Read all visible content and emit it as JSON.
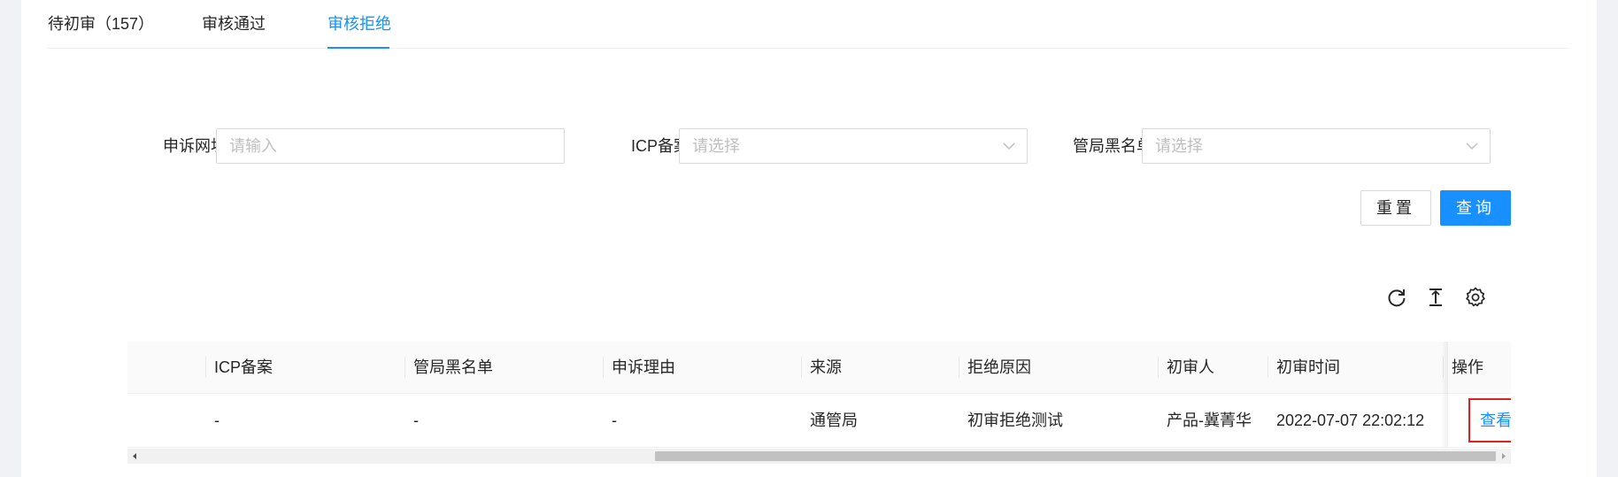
{
  "tabs": [
    {
      "label": "待初审（157）",
      "active": false
    },
    {
      "label": "审核通过",
      "active": false
    },
    {
      "label": "审核拒绝",
      "active": true
    }
  ],
  "filters": {
    "url_label": "申诉网址:",
    "url_placeholder": "请输入",
    "icp_label": "ICP备案:",
    "icp_placeholder": "请选择",
    "blacklist_label": "管局黑名单:",
    "blacklist_placeholder": "请选择"
  },
  "buttons": {
    "reset": "重置",
    "query": "查询"
  },
  "toolbar": {
    "icons": [
      "reload-icon",
      "column-height-icon",
      "setting-icon"
    ]
  },
  "table": {
    "columns": [
      "ICP备案",
      "管局黑名单",
      "申诉理由",
      "来源",
      "拒绝原因",
      "初审人",
      "初审时间",
      "操作"
    ],
    "rows": [
      {
        "icp": "-",
        "blacklist": "-",
        "reason": "-",
        "source": "通管局",
        "reject_reason": "初审拒绝测试",
        "reviewer": "产品-冀菁华",
        "review_time": "2022-07-07 22:02:12",
        "action": "查看"
      }
    ]
  },
  "colors": {
    "primary": "#1890ff",
    "highlight_border": "#e02020"
  }
}
